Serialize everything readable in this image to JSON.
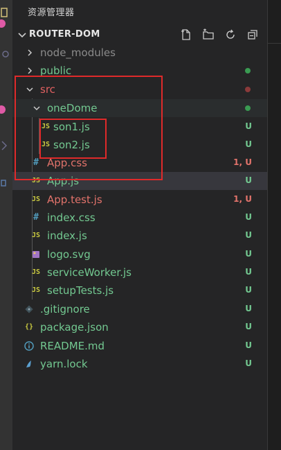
{
  "sidebar": {
    "title": "资源管理器",
    "section_title": "ROUTER-DOM",
    "actions": [
      {
        "name": "new-file-icon"
      },
      {
        "name": "new-folder-icon"
      },
      {
        "name": "refresh-icon"
      },
      {
        "name": "collapse-all-icon"
      }
    ]
  },
  "colors": {
    "green_status": "#73c991",
    "red_status": "#e06c75",
    "modified_red": "#e2736b",
    "folder_text": "#e06060",
    "dot_green": "#3a9b52",
    "dot_red": "#8b3a3a",
    "annotation": "#e02a2a"
  },
  "tree": {
    "node_modules": {
      "label": "node_modules"
    },
    "public": {
      "label": "public"
    },
    "src": {
      "label": "src"
    },
    "oneDome": {
      "label": "oneDome"
    },
    "son1": {
      "label": "son1.js",
      "status": "U",
      "icon": "JS"
    },
    "son2": {
      "label": "son2.js",
      "status": "U",
      "icon": "JS"
    },
    "app_css": {
      "label": "App.css",
      "status": "1, U",
      "icon": "#"
    },
    "app_js": {
      "label": "App.js",
      "status": "U",
      "icon": "JS"
    },
    "app_test": {
      "label": "App.test.js",
      "status": "1, U",
      "icon": "JS"
    },
    "index_css": {
      "label": "index.css",
      "status": "U",
      "icon": "#"
    },
    "index_js": {
      "label": "index.js",
      "status": "U",
      "icon": "JS"
    },
    "logo": {
      "label": "logo.svg",
      "status": "U"
    },
    "service_worker": {
      "label": "serviceWorker.js",
      "status": "U",
      "icon": "JS"
    },
    "setup_tests": {
      "label": "setupTests.js",
      "status": "U",
      "icon": "JS"
    },
    "gitignore": {
      "label": ".gitignore",
      "status": "U"
    },
    "package_json": {
      "label": "package.json",
      "status": "U",
      "icon": "{}"
    },
    "readme": {
      "label": "README.md",
      "status": "U"
    },
    "yarn_lock": {
      "label": "yarn.lock",
      "status": "U"
    }
  }
}
